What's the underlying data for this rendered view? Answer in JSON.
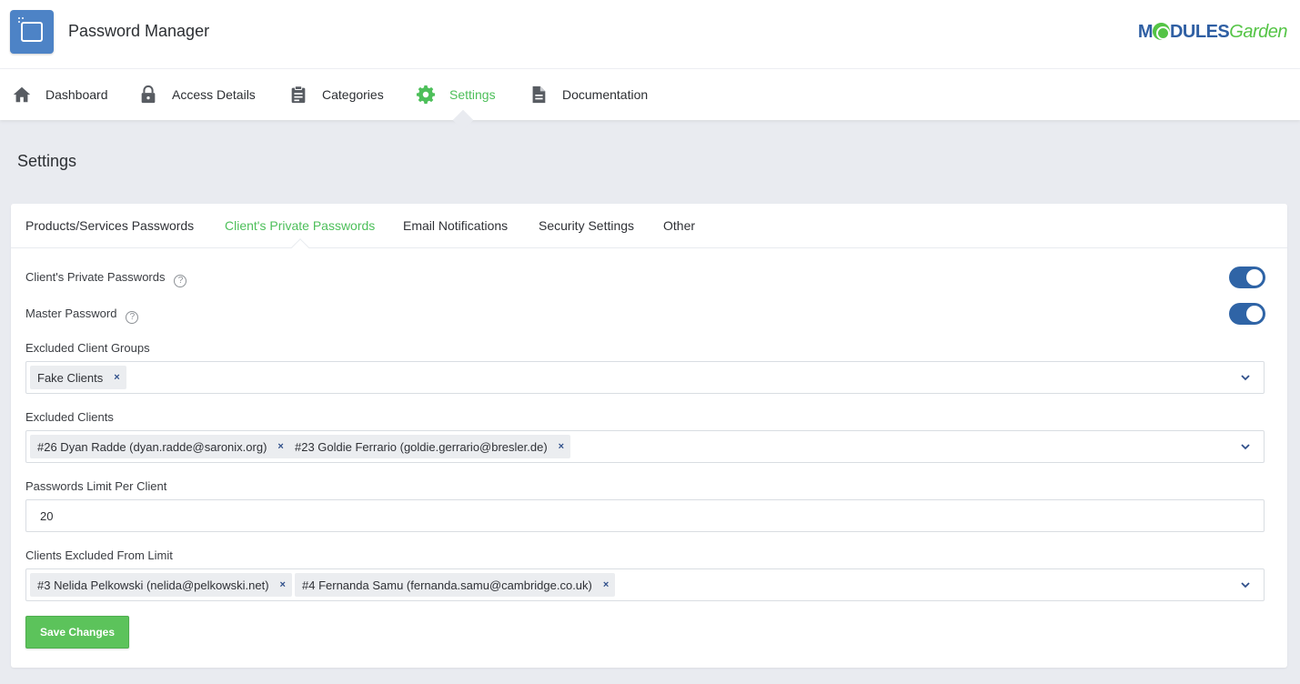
{
  "app": {
    "title": "Password Manager",
    "brand_part1": "M",
    "brand_part2": "DULES",
    "brand_part3": "Garden"
  },
  "nav": {
    "items": [
      {
        "label": "Dashboard",
        "icon": "home-icon"
      },
      {
        "label": "Access Details",
        "icon": "lock-icon"
      },
      {
        "label": "Categories",
        "icon": "clipboard-icon"
      },
      {
        "label": "Settings",
        "icon": "gear-icon",
        "active": true
      },
      {
        "label": "Documentation",
        "icon": "document-icon"
      }
    ]
  },
  "page": {
    "title": "Settings"
  },
  "tabs": [
    {
      "label": "Products/Services Passwords"
    },
    {
      "label": "Client's Private Passwords",
      "active": true
    },
    {
      "label": "Email Notifications"
    },
    {
      "label": "Security Settings"
    },
    {
      "label": "Other"
    }
  ],
  "form": {
    "private_passwords": {
      "label": "Client's Private Passwords",
      "enabled": true
    },
    "master_password": {
      "label": "Master Password",
      "enabled": true
    },
    "excluded_groups": {
      "label": "Excluded Client Groups",
      "chips": [
        "Fake Clients"
      ]
    },
    "excluded_clients": {
      "label": "Excluded Clients",
      "chips": [
        "#26 Dyan Radde (dyan.radde@saronix.org)",
        "#23 Goldie Ferrario (goldie.gerrario@bresler.de)"
      ]
    },
    "passwords_limit": {
      "label": "Passwords Limit Per Client",
      "value": "20"
    },
    "excluded_from_limit": {
      "label": "Clients Excluded From Limit",
      "chips": [
        "#3 Nelida Pelkowski (nelida@pelkowski.net)",
        "#4 Fernanda Samu (fernanda.samu@cambridge.co.uk)"
      ]
    },
    "remove_symbol": "×",
    "help_symbol": "?",
    "save_label": "Save Changes"
  },
  "colors": {
    "accent": "#4dbf5a",
    "toggle": "#2f64a6",
    "button": "#5cc35b",
    "background": "#e9ebf0"
  }
}
